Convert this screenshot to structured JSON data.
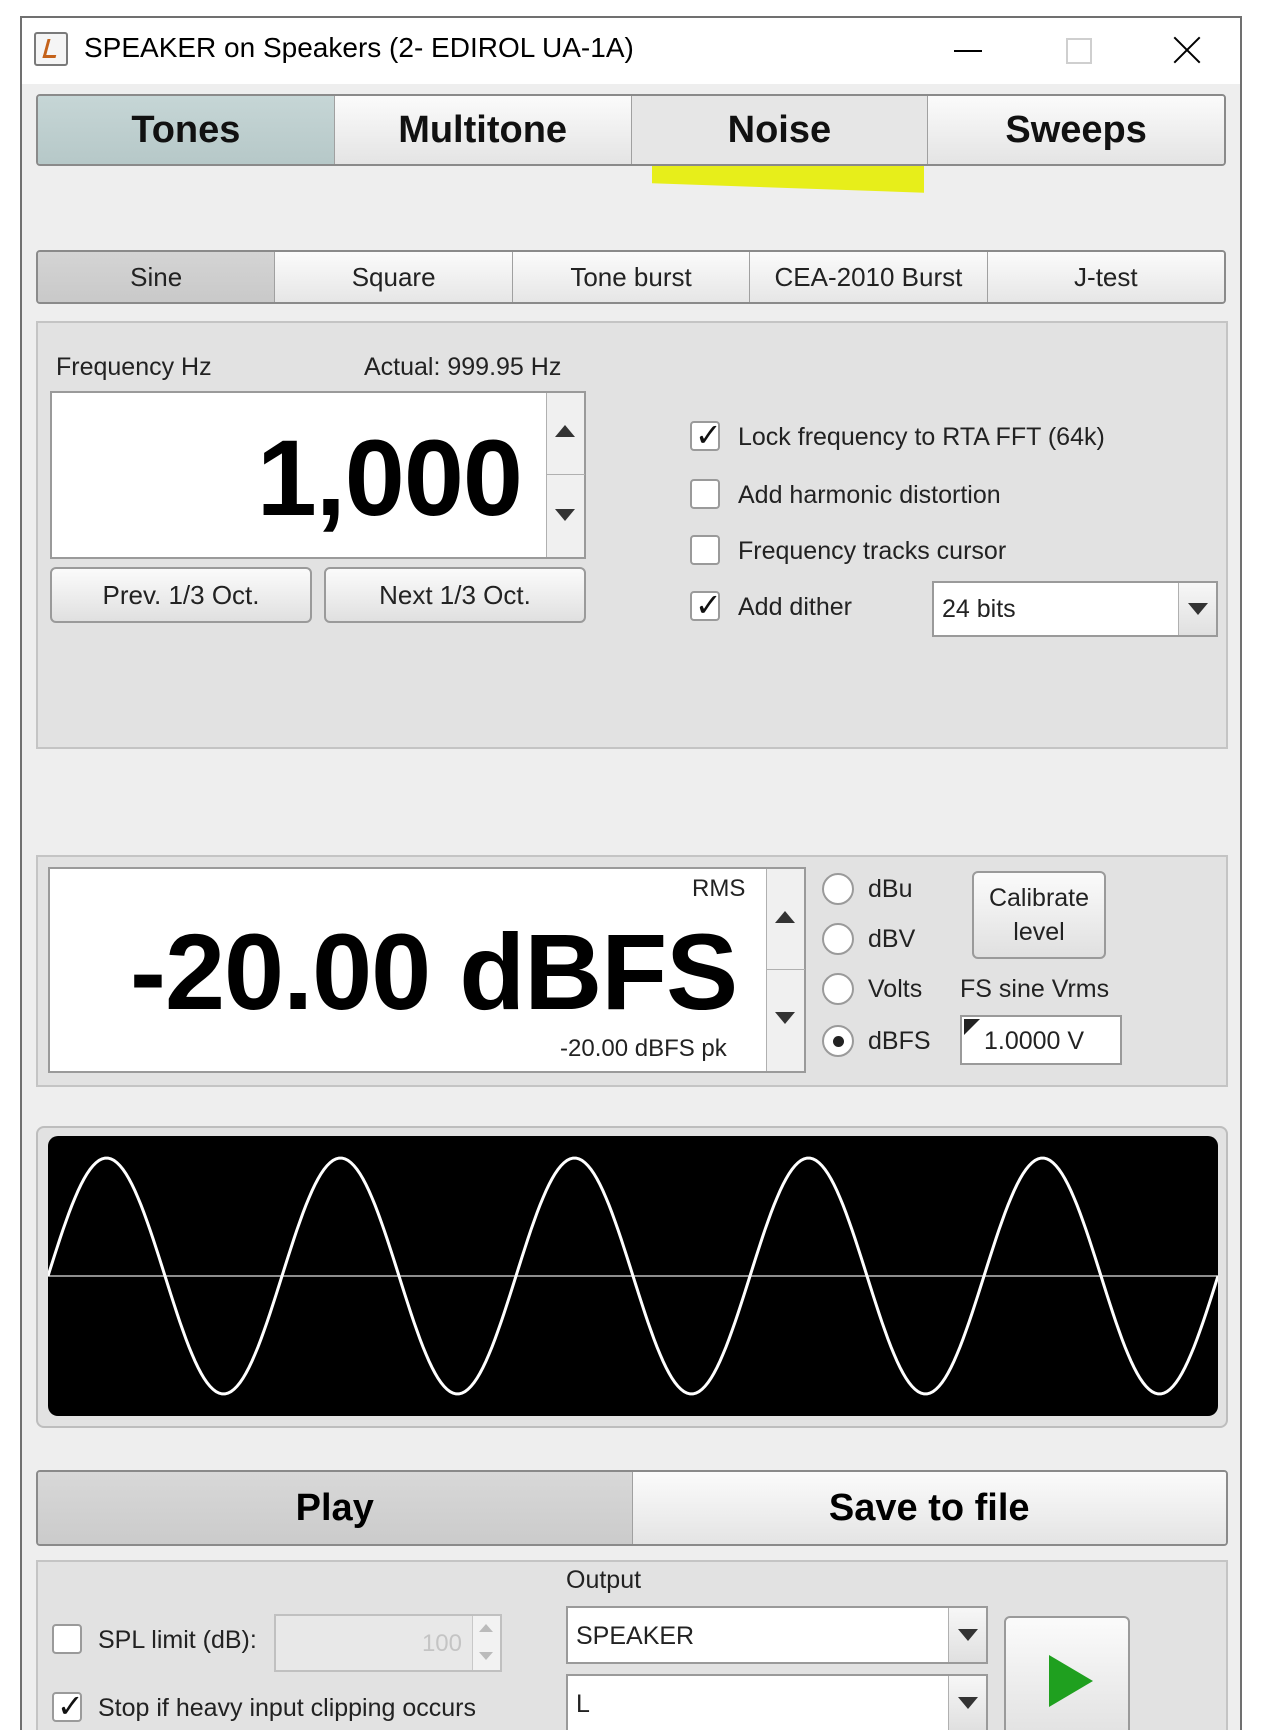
{
  "window": {
    "title": "SPEAKER on Speakers (2- EDIROL UA-1A)"
  },
  "main_tabs": [
    {
      "label": "Tones",
      "active": true
    },
    {
      "label": "Multitone",
      "active": false
    },
    {
      "label": "Noise",
      "active": false,
      "highlighted": true
    },
    {
      "label": "Sweeps",
      "active": false
    }
  ],
  "sub_tabs": [
    {
      "label": "Sine",
      "active": true
    },
    {
      "label": "Square",
      "active": false
    },
    {
      "label": "Tone burst",
      "active": false
    },
    {
      "label": "CEA-2010 Burst",
      "active": false
    },
    {
      "label": "J-test",
      "active": false
    }
  ],
  "frequency": {
    "label": "Frequency Hz",
    "actual": "Actual: 999.95 Hz",
    "value": "1,000",
    "prev_button": "Prev. 1/3 Oct.",
    "next_button": "Next 1/3 Oct."
  },
  "options": {
    "lock_frequency": {
      "label": "Lock frequency to RTA FFT (64k)",
      "checked": true
    },
    "harmonic_distortion": {
      "label": "Add harmonic distortion",
      "checked": false
    },
    "frequency_tracks": {
      "label": "Frequency tracks cursor",
      "checked": false
    },
    "add_dither": {
      "label": "Add dither",
      "checked": true
    },
    "dither_bits": "24 bits"
  },
  "level": {
    "rms_label": "RMS",
    "value": "-20.00 dBFS",
    "peak": "-20.00 dBFS pk",
    "units": [
      {
        "label": "dBu",
        "selected": false
      },
      {
        "label": "dBV",
        "selected": false
      },
      {
        "label": "Volts",
        "selected": false
      },
      {
        "label": "dBFS",
        "selected": true
      }
    ],
    "calibrate_button_line1": "Calibrate",
    "calibrate_button_line2": "level",
    "fs_label": "FS sine Vrms",
    "fs_value": "1.0000 V"
  },
  "waveform": {
    "cycles": 5,
    "background": "#000000",
    "line_color": "#ffffff"
  },
  "actions": {
    "play_label": "Play",
    "save_label": "Save to file"
  },
  "output": {
    "spl_limit": {
      "label": "SPL limit (dB):",
      "checked": false,
      "value": "100"
    },
    "stop_clipping": {
      "label": "Stop if heavy input clipping occurs",
      "checked": true
    },
    "output_label": "Output",
    "device": "SPEAKER",
    "channel": "L",
    "play_icon_color": "#1fa01f"
  },
  "colors": {
    "highlight": "#e7ee1a",
    "active_tab": "#bccdcd"
  }
}
